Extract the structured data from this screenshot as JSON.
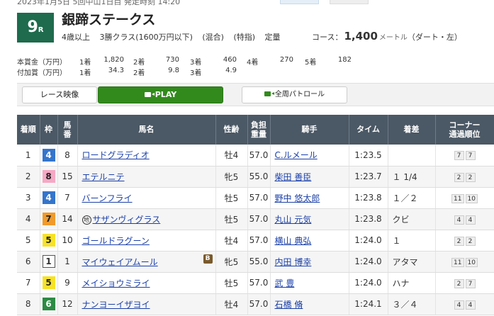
{
  "header": {
    "top_partial_text": "2023年1月5日  5回中山1日目  発走時刻 14:20",
    "race_number": "9",
    "race_suffix": "R",
    "race_name": "銀蹄ステークス",
    "conditions": [
      "4歳以上",
      "3勝クラス(1600万円以下)",
      "(混合)",
      "(特指)",
      "定量"
    ],
    "course_label": "コース：",
    "distance": "1,400",
    "distance_unit": "メートル",
    "course_type": "（ダート・左）"
  },
  "prize": {
    "main_label": "本賞金（万円）",
    "extra_label": "付加賞（万円）",
    "main": [
      {
        "place": "1着",
        "value": "1,820"
      },
      {
        "place": "2着",
        "value": "730"
      },
      {
        "place": "3着",
        "value": "460"
      },
      {
        "place": "4着",
        "value": "270"
      },
      {
        "place": "5着",
        "value": "182"
      }
    ],
    "extra": [
      {
        "place": "1着",
        "value": "34.3"
      },
      {
        "place": "2着",
        "value": "9.8"
      },
      {
        "place": "3着",
        "value": "4.9"
      }
    ]
  },
  "toolbar": {
    "video_label": "レース映像",
    "play_label": "PLAY",
    "patrol_label": "全周パトロール"
  },
  "table": {
    "headers": {
      "rank": "着順",
      "waku": "枠",
      "umaban_1": "馬",
      "umaban_2": "番",
      "horse": "馬名",
      "sexage": "性齢",
      "weight_1": "負担",
      "weight_2": "重量",
      "jockey": "騎手",
      "time": "タイム",
      "margin": "着差",
      "corner_1": "コーナー",
      "corner_2": "通過順位"
    },
    "rows": [
      {
        "rank": "1",
        "waku": "4",
        "num": "8",
        "horse": "ロードグラディオ",
        "mark": "",
        "blinker": "",
        "sexage": "牡4",
        "weight": "57.0",
        "jockey": "C.ルメール",
        "time": "1:23.5",
        "margin": "",
        "corners": [
          "7",
          "7"
        ]
      },
      {
        "rank": "2",
        "waku": "8",
        "num": "15",
        "horse": "エテルニテ",
        "mark": "",
        "blinker": "",
        "sexage": "牝5",
        "weight": "55.0",
        "jockey": "柴田 善臣",
        "time": "1:23.7",
        "margin": "１ 1/4",
        "corners": [
          "2",
          "2"
        ]
      },
      {
        "rank": "3",
        "waku": "4",
        "num": "7",
        "horse": "バーンフライ",
        "mark": "",
        "blinker": "",
        "sexage": "牡5",
        "weight": "57.0",
        "jockey": "野中 悠太郎",
        "time": "1:23.8",
        "margin": "１／２",
        "corners": [
          "11",
          "10"
        ]
      },
      {
        "rank": "4",
        "waku": "7",
        "num": "14",
        "horse": "サザンヴィグラス",
        "mark": "地",
        "blinker": "",
        "sexage": "牡5",
        "weight": "57.0",
        "jockey": "丸山 元気",
        "time": "1:23.8",
        "margin": "クビ",
        "corners": [
          "4",
          "4"
        ]
      },
      {
        "rank": "5",
        "waku": "5",
        "num": "10",
        "horse": "ゴールドラグーン",
        "mark": "",
        "blinker": "",
        "sexage": "牡4",
        "weight": "57.0",
        "jockey": "横山 典弘",
        "time": "1:24.0",
        "margin": "１",
        "corners": [
          "2",
          "2"
        ]
      },
      {
        "rank": "6",
        "waku": "1",
        "num": "1",
        "horse": "マイウェイアムール",
        "mark": "",
        "blinker": "B",
        "sexage": "牝5",
        "weight": "55.0",
        "jockey": "内田 博幸",
        "time": "1:24.0",
        "margin": "アタマ",
        "corners": [
          "11",
          "10"
        ]
      },
      {
        "rank": "7",
        "waku": "5",
        "num": "9",
        "horse": "メイショウミライ",
        "mark": "",
        "blinker": "",
        "sexage": "牡5",
        "weight": "57.0",
        "jockey": "武 豊",
        "time": "1:24.0",
        "margin": "ハナ",
        "corners": [
          "2",
          "7"
        ]
      },
      {
        "rank": "8",
        "waku": "6",
        "num": "12",
        "horse": "ナンヨーイザヨイ",
        "mark": "",
        "blinker": "",
        "sexage": "牡4",
        "weight": "57.0",
        "jockey": "石橋 脩",
        "time": "1:24.1",
        "margin": "３／４",
        "corners": [
          "4",
          "4"
        ]
      }
    ]
  }
}
